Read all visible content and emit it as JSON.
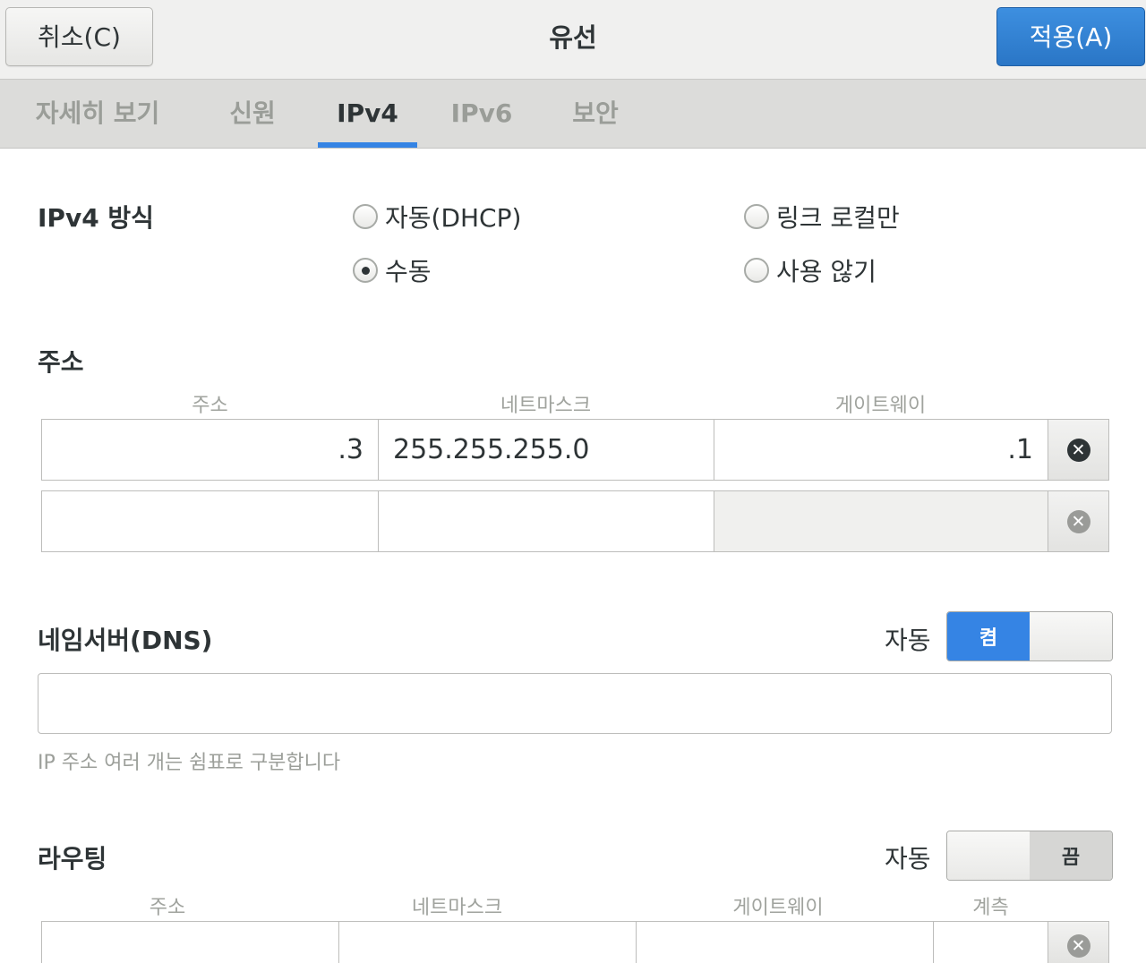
{
  "header": {
    "cancel_label": "취소(C)",
    "title": "유선",
    "apply_label": "적용(A)"
  },
  "tabs": [
    {
      "label": "자세히 보기",
      "active": false
    },
    {
      "label": "신원",
      "active": false
    },
    {
      "label": "IPv4",
      "active": true
    },
    {
      "label": "IPv6",
      "active": false
    },
    {
      "label": "보안",
      "active": false
    }
  ],
  "ipv4_method": {
    "label": "IPv4 방식",
    "options": [
      {
        "label": "자동(DHCP)",
        "checked": false
      },
      {
        "label": "링크 로컬만",
        "checked": false
      },
      {
        "label": "수동",
        "checked": true
      },
      {
        "label": "사용 않기",
        "checked": false
      }
    ]
  },
  "addresses": {
    "title": "주소",
    "columns": [
      "주소",
      "네트마스크",
      "게이트웨이"
    ],
    "rows": [
      {
        "address": ".3",
        "netmask": "255.255.255.0",
        "gateway": ".1"
      },
      {
        "address": "",
        "netmask": "",
        "gateway": ""
      }
    ]
  },
  "dns": {
    "title": "네임서버(DNS)",
    "auto_label": "자동",
    "toggle_label": "켬",
    "toggle_on": true,
    "value": "",
    "hint": "IP 주소 여러 개는 쉼표로 구분합니다"
  },
  "routes": {
    "title": "라우팅",
    "auto_label": "자동",
    "toggle_label": "끔",
    "toggle_on": false,
    "columns": [
      "주소",
      "네트마스크",
      "게이트웨이",
      "계측"
    ]
  },
  "colors": {
    "accent": "#3584e4",
    "text": "#2e3436"
  }
}
